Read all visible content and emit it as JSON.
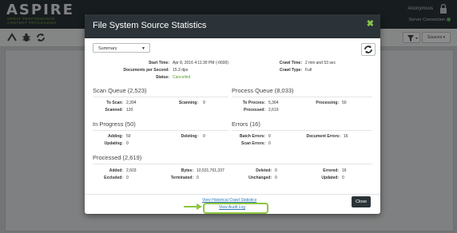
{
  "app": {
    "logo": "ASPIRE",
    "logo_sub": "GREAT PERFORMANCE. CONTENT PROCESSING",
    "user": "Anonymous",
    "server_connection": "Server Connection",
    "sources_label": "Sources",
    "accent": "#8dc63f",
    "header_bg": "#2b3338"
  },
  "modal": {
    "title": "File System Source Statistics",
    "view_select": "Summary",
    "summary": {
      "start_time_label": "Start Time:",
      "start_time": "Apr 8, 2016 4:11:30 PM (-0600)",
      "docs_per_second_label": "Documents per Second:",
      "docs_per_second": "15.3 dps",
      "status_label": "Status:",
      "status": "Cancelled",
      "crawl_time_label": "Crawl Time:",
      "crawl_time": "2 min and 53 sec",
      "crawl_type_label": "Crawl Type:",
      "crawl_type": "Full"
    },
    "scan_queue": {
      "title": "Scan Queue (2,523)",
      "to_scan_label": "To Scan:",
      "to_scan": "2,394",
      "scanning_label": "Scanning:",
      "scanning": "9",
      "scanned_label": "Scanned:",
      "scanned": "120"
    },
    "process_queue": {
      "title": "Process Queue (8,033)",
      "to_process_label": "To Process:",
      "to_process": "5,364",
      "processing_label": "Processing:",
      "processing": "50",
      "processed_label": "Processed:",
      "processed": "2,619"
    },
    "in_progress": {
      "title": "In Progress (50)",
      "adding_label": "Adding:",
      "adding": "50",
      "deleting_label": "Deleting:",
      "deleting": "0",
      "updating_label": "Updating:",
      "updating": "0"
    },
    "errors": {
      "title": "Errors (16)",
      "batch_errors_label": "Batch Errors:",
      "batch_errors": "0",
      "document_errors_label": "Document Errors:",
      "document_errors": "16",
      "scan_errors_label": "Scan Errors:",
      "scan_errors": "0"
    },
    "processed": {
      "title": "Processed (2,619)",
      "added_label": "Added:",
      "added": "2,603",
      "bytes_label": "Bytes:",
      "bytes": "10,531,761,337",
      "deleted_label": "Deleted:",
      "deleted": "0",
      "errored_label": "Errored:",
      "errored": "16",
      "excluded_label": "Excluded:",
      "excluded": "0",
      "terminated_label": "Terminated:",
      "terminated": "0",
      "unchanged_label": "Unchanged:",
      "unchanged": "0",
      "updated_label": "Updated:",
      "updated": "0"
    },
    "footer": {
      "historical_link": "View Historical Crawl Statistics",
      "audit_link": "View Audit Log",
      "close_label": "Close"
    }
  }
}
